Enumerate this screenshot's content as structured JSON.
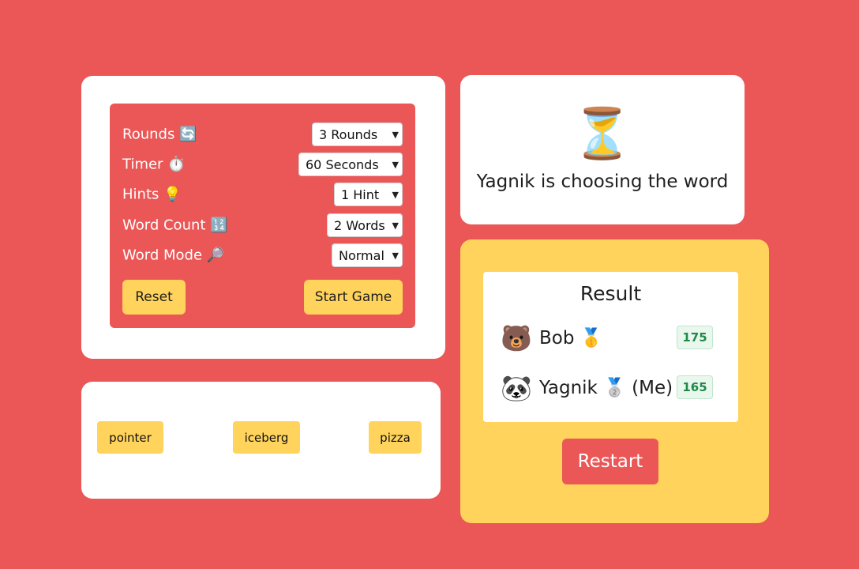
{
  "settings": {
    "rows": [
      {
        "label": "Rounds 🔄",
        "value": "3 Rounds"
      },
      {
        "label": "Timer ⏱️",
        "value": "60 Seconds"
      },
      {
        "label": "Hints 💡",
        "value": "1 Hint"
      },
      {
        "label": "Word Count 🔢",
        "value": "2 Words"
      },
      {
        "label": "Word Mode 🔎",
        "value": "Normal"
      }
    ],
    "reset_label": "Reset",
    "start_label": "Start Game"
  },
  "words": [
    "pointer",
    "iceberg",
    "pizza"
  ],
  "status": {
    "icon": "⏳",
    "text": "Yagnik is choosing the word"
  },
  "result": {
    "title": "Result",
    "players": [
      {
        "avatar": "🐻",
        "name": "Bob 🥇",
        "score": "175"
      },
      {
        "avatar": "🐼",
        "name": "Yagnik 🥈 (Me)",
        "score": "165"
      }
    ],
    "restart_label": "Restart"
  },
  "colors": {
    "background": "#EB5757",
    "accent_yellow": "#FFD35C",
    "score_green": "#1E8B45"
  },
  "icons": [
    "hourglass-icon",
    "bear-avatar-icon",
    "panda-avatar-icon"
  ]
}
